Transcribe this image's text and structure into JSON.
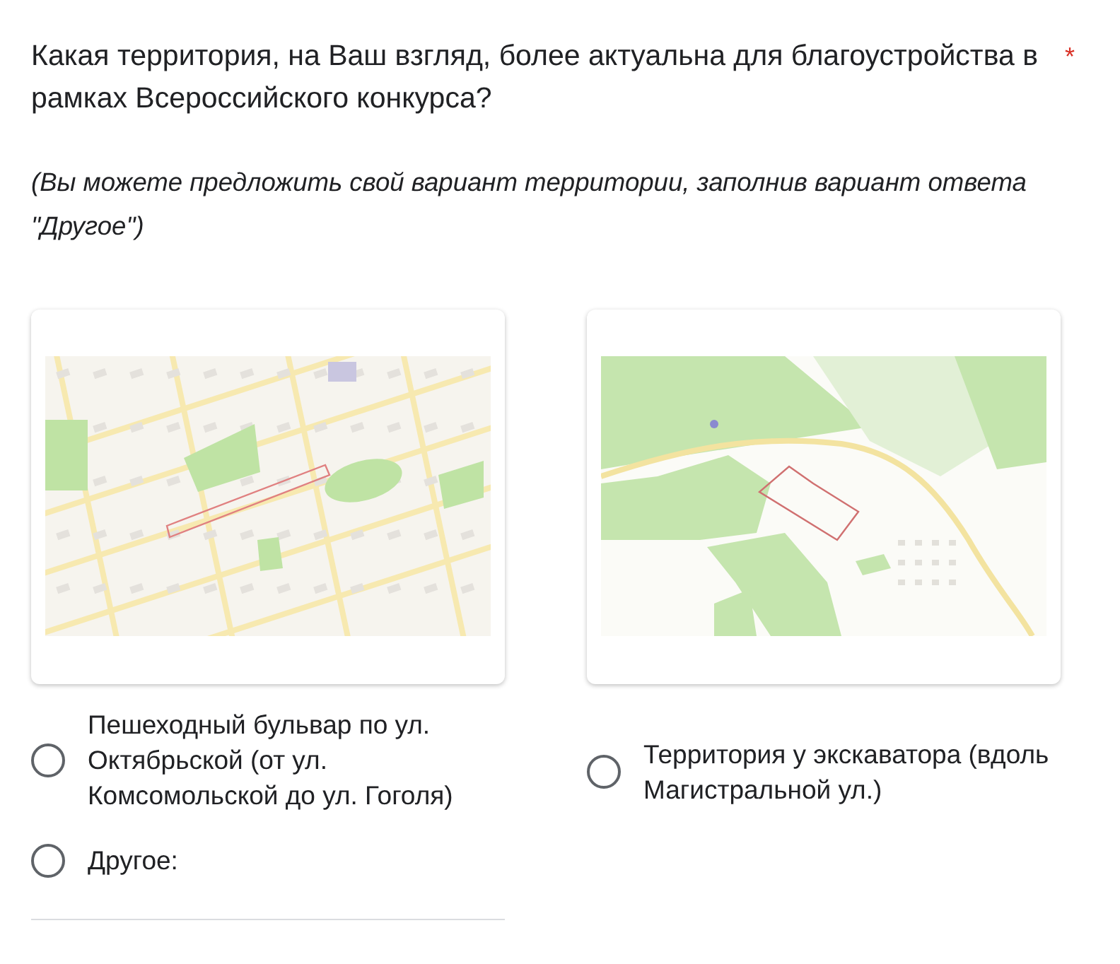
{
  "question": {
    "title": "Какая территория, на Ваш взгляд, более актуальна для благоустройства в рамках Всероссийского конкурса?",
    "required_mark": "*",
    "hint": "(Вы можете предложить свой вариант территории, заполнив вариант ответа \"Другое\")"
  },
  "options": [
    {
      "kind": "image",
      "label": "Пешеходный бульвар по ул. Октябрьской (от ул. Комсомольской до ул. Гоголя)",
      "selected": false
    },
    {
      "kind": "image",
      "label": "Территория у экскаватора (вдоль Магистральной ул.)",
      "selected": false
    },
    {
      "kind": "other",
      "label": "Другое:",
      "selected": false
    }
  ]
}
